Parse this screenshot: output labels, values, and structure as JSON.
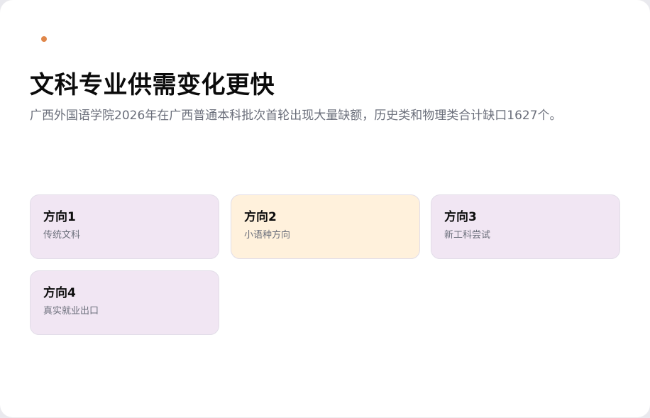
{
  "colors": {
    "accent_dot": "#e0874a",
    "tile_lavender": "#f1e6f3",
    "tile_peach": "#fff1dc"
  },
  "header": {
    "title": "文科专业供需变化更快",
    "subtitle": "广西外国语学院2026年在广西普通本科批次首轮出现大量缺额，历史类和物理类合计缺口1627个。"
  },
  "directions": [
    {
      "title": "方向1",
      "desc": "传统文科",
      "color": "#f1e6f3"
    },
    {
      "title": "方向2",
      "desc": "小语种方向",
      "color": "#fff1dc"
    },
    {
      "title": "方向3",
      "desc": "新工科尝试",
      "color": "#f1e6f3"
    },
    {
      "title": "方向4",
      "desc": "真实就业出口",
      "color": "#f1e6f3"
    }
  ]
}
